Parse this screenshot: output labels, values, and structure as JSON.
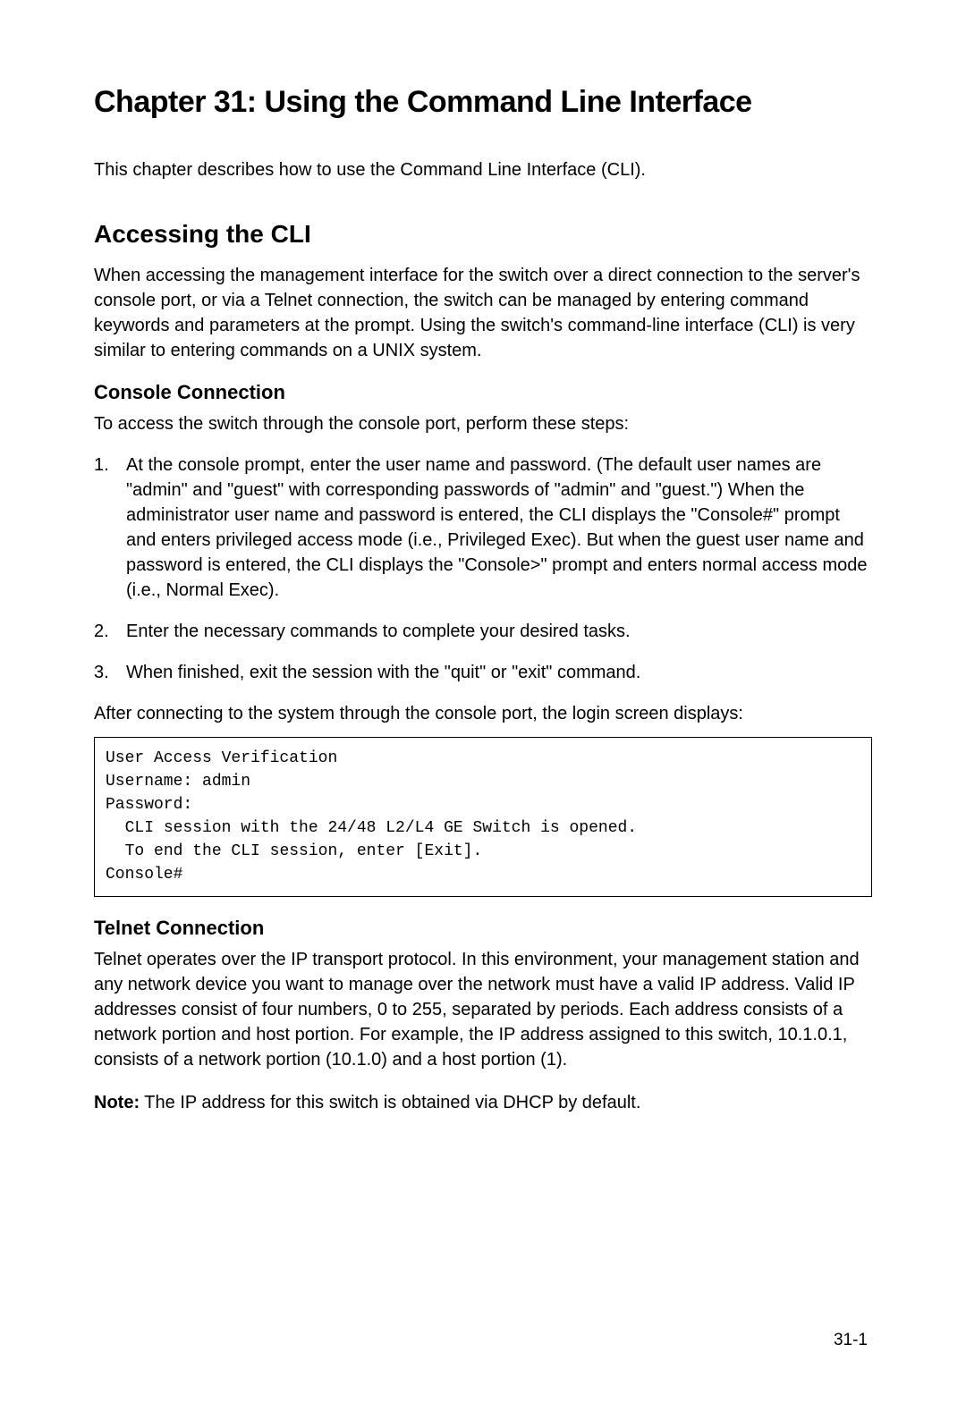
{
  "chapterTitle": "Chapter 31: Using the Command Line Interface",
  "intro": "This chapter describes how to use the Command Line Interface (CLI).",
  "section1": {
    "title": "Accessing the CLI",
    "body": "When accessing the management interface for the switch over a direct connection to the server's console port, or via a Telnet connection, the switch can be managed by entering command keywords and parameters at the prompt. Using the switch's command-line interface (CLI) is very similar to entering commands on a UNIX system."
  },
  "sub1": {
    "title": "Console Connection",
    "intro": "To access the switch through the console port, perform these steps:",
    "steps": [
      "At the console prompt, enter the user name and password. (The default user names are \"admin\" and \"guest\" with corresponding passwords of \"admin\" and \"guest.\") When the administrator user name and password is entered, the CLI displays the \"Console#\" prompt and enters privileged access mode (i.e., Privileged Exec). But when the guest user name and password is entered, the CLI displays the \"Console>\" prompt and enters normal access mode (i.e., Normal Exec).",
      "Enter the necessary commands to complete your desired tasks.",
      "When finished, exit the session with the \"quit\" or \"exit\" command."
    ],
    "afterList": "After connecting to the system through the console port, the login screen displays:",
    "code": "User Access Verification\nUsername: admin\nPassword:\n  CLI session with the 24/48 L2/L4 GE Switch is opened.\n  To end the CLI session, enter [Exit].\nConsole#"
  },
  "sub2": {
    "title": "Telnet Connection",
    "body": "Telnet operates over the IP transport protocol. In this environment, your management station and any network device you want to manage over the network must have a valid IP address. Valid IP addresses consist of four numbers, 0 to 255, separated by periods. Each address consists of a network portion and host portion. For example, the IP address assigned to this switch, 10.1.0.1, consists of a network portion (10.1.0) and a host portion (1).",
    "noteLabel": "Note:",
    "noteText": " The IP address for this switch is obtained via DHCP by default."
  },
  "pageNumber": "31-1"
}
